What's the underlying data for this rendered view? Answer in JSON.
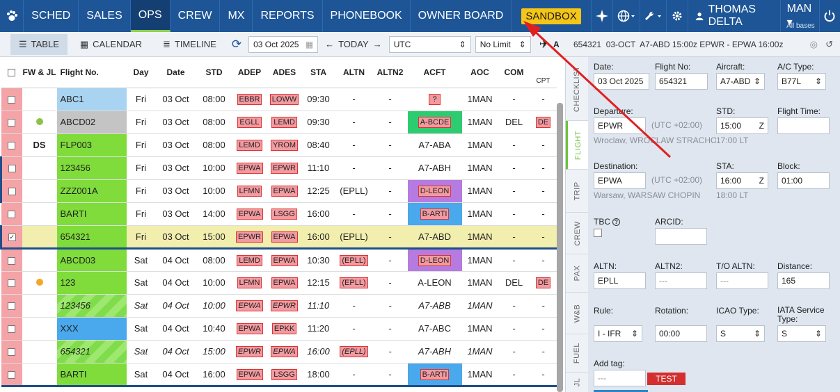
{
  "nav": {
    "items": [
      "SCHED",
      "SALES",
      "OPS",
      "CREW",
      "MX",
      "REPORTS",
      "PHONEBOOK",
      "OWNER BOARD"
    ],
    "sandbox": "SANDBOX",
    "user": "THOMAS DELTA",
    "base": "MAN",
    "base_sub": "All bases"
  },
  "toolbar": {
    "table": "TABLE",
    "calendar": "CALENDAR",
    "timeline": "TIMELINE",
    "date": "03 Oct 2025",
    "today": "TODAY",
    "timezone": "UTC",
    "limit": "No Limit",
    "extra": "A"
  },
  "columns": [
    "FW & JL",
    "Flight No.",
    "Day",
    "Date",
    "STD",
    "ADEP",
    "ADES",
    "STA",
    "ALTN",
    "ALTN2",
    "ACFT",
    "AOC",
    "COM",
    "CPT"
  ],
  "rows": [
    {
      "flight": "ABC1",
      "day": "Fri",
      "date": "03 Oct",
      "std": "08:00",
      "adep": "EBBR",
      "ades": "LOWW",
      "sta": "09:30",
      "altn": "-",
      "altn2": "-",
      "acft": "?",
      "aoc": "1MAN",
      "com": "-",
      "cpt": "-"
    },
    {
      "flight": "ABCD02",
      "day": "Fri",
      "date": "03 Oct",
      "std": "08:00",
      "adep": "EGLL",
      "ades": "LEMD",
      "sta": "09:30",
      "altn": "-",
      "altn2": "-",
      "acft": "A-BCDE",
      "aoc": "1MAN",
      "com": "DEL",
      "cpt": "DE"
    },
    {
      "fw": "DS",
      "flight": "FLP003",
      "day": "Fri",
      "date": "03 Oct",
      "std": "08:00",
      "adep": "LEMD",
      "ades": "YROM",
      "sta": "08:40",
      "altn": "-",
      "altn2": "-",
      "acft": "A7-ABA",
      "aoc": "1MAN",
      "com": "-",
      "cpt": "-"
    },
    {
      "flight": "123456",
      "day": "Fri",
      "date": "03 Oct",
      "std": "10:00",
      "adep": "EPWA",
      "ades": "EPWR",
      "sta": "11:10",
      "altn": "-",
      "altn2": "-",
      "acft": "A7-ABH",
      "aoc": "1MAN",
      "com": "-",
      "cpt": "-"
    },
    {
      "flight": "ZZZ001A",
      "day": "Fri",
      "date": "03 Oct",
      "std": "10:00",
      "adep": "LFMN",
      "ades": "EPWA",
      "sta": "12:25",
      "altn": "(EPLL)",
      "altn2": "-",
      "acft": "D-LEON",
      "aoc": "1MAN",
      "com": "-",
      "cpt": "-"
    },
    {
      "flight": "BARTI",
      "day": "Fri",
      "date": "03 Oct",
      "std": "14:00",
      "adep": "EPWA",
      "ades": "LSGG",
      "sta": "16:00",
      "altn": "-",
      "altn2": "-",
      "acft": "B-ARTI",
      "aoc": "1MAN",
      "com": "-",
      "cpt": "-"
    },
    {
      "flight": "654321",
      "day": "Fri",
      "date": "03 Oct",
      "std": "15:00",
      "adep": "EPWR",
      "ades": "EPWA",
      "sta": "16:00",
      "altn": "(EPLL)",
      "altn2": "-",
      "acft": "A7-ABD",
      "aoc": "1MAN",
      "com": "-",
      "cpt": "-"
    },
    {
      "flight": "ABCD03",
      "day": "Sat",
      "date": "04 Oct",
      "std": "08:00",
      "adep": "LEMD",
      "ades": "EPWA",
      "sta": "10:30",
      "altn": "(EPLL)",
      "altn2": "-",
      "acft": "D-LEON",
      "aoc": "1MAN",
      "com": "-",
      "cpt": "-"
    },
    {
      "flight": "123",
      "day": "Sat",
      "date": "04 Oct",
      "std": "10:00",
      "adep": "LFMN",
      "ades": "EPWA",
      "sta": "12:15",
      "altn": "(EPLL)",
      "altn2": "-",
      "acft": "A-LEON",
      "aoc": "1MAN",
      "com": "DEL",
      "cpt": "DE"
    },
    {
      "flight": "123456",
      "day": "Sat",
      "date": "04 Oct",
      "std": "10:00",
      "adep": "EPWA",
      "ades": "EPWR",
      "sta": "11:10",
      "altn": "-",
      "altn2": "-",
      "acft": "A7-ABB",
      "aoc": "1MAN",
      "com": "-",
      "cpt": "-"
    },
    {
      "flight": "XXX",
      "day": "Sat",
      "date": "04 Oct",
      "std": "10:40",
      "adep": "EPWA",
      "ades": "EPKK",
      "sta": "11:20",
      "altn": "-",
      "altn2": "-",
      "acft": "A7-ABC",
      "aoc": "1MAN",
      "com": "-",
      "cpt": "-"
    },
    {
      "flight": "654321",
      "day": "Sat",
      "date": "04 Oct",
      "std": "15:00",
      "adep": "EPWR",
      "ades": "EPWA",
      "sta": "16:00",
      "altn": "(EPLL)",
      "altn2": "-",
      "acft": "A7-ABH",
      "aoc": "1MAN",
      "com": "-",
      "cpt": "-"
    },
    {
      "flight": "BARTI",
      "day": "Sat",
      "date": "04 Oct",
      "std": "16:00",
      "adep": "EPWA",
      "ades": "LSGG",
      "sta": "18:00",
      "altn": "-",
      "altn2": "-",
      "acft": "B-ARTI",
      "aoc": "1MAN",
      "com": "-",
      "cpt": "-"
    }
  ],
  "vtabs": [
    "CHECKLIST",
    "FLIGHT",
    "TRIP",
    "CREW",
    "PAX",
    "W&B",
    "FUEL",
    "JL"
  ],
  "panel": {
    "header": "654321  03-OCT  A7-ABD 15:00z EPWR - EPWA 16:00z",
    "date_label": "Date:",
    "date": "03 Oct 2025",
    "flightno_label": "Flight No:",
    "flightno": "654321",
    "aircraft_label": "Aircraft:",
    "aircraft": "A7-ABD",
    "actype_label": "A/C Type:",
    "actype": "B77L",
    "departure_label": "Departure:",
    "departure": "EPWR",
    "dep_tz": "(UTC +02:00)",
    "dep_name": "Wroclaw, WROCLAW STRACHO...",
    "std_label": "STD:",
    "std": "15:00",
    "std_z": "Z",
    "std_lt": "17:00 LT",
    "flighttime_label": "Flight Time:",
    "destination_label": "Destination:",
    "destination": "EPWA",
    "dest_tz": "(UTC +02:00)",
    "dest_name": "Warsaw, WARSAW CHOPIN",
    "sta_label": "STA:",
    "sta": "16:00",
    "sta_z": "Z",
    "sta_lt": "18:00 LT",
    "block_label": "Block:",
    "block": "01:00",
    "tbc_label": "TBC",
    "arcid_label": "ARCID:",
    "altn_label": "ALTN:",
    "altn": "EPLL",
    "altn2_label": "ALTN2:",
    "altn2": "---",
    "toaltn_label": "T/O ALTN:",
    "toaltn": "---",
    "distance_label": "Distance:",
    "distance": "165",
    "rule_label": "Rule:",
    "rule": "I - IFR",
    "rotation_label": "Rotation:",
    "rotation": "00:00",
    "icao_label": "ICAO Type:",
    "icao": "S",
    "iata_label": "IATA Service Type:",
    "iata": "S",
    "addtag_label": "Add tag:",
    "addtag": "---",
    "test_tag": "TEST"
  }
}
